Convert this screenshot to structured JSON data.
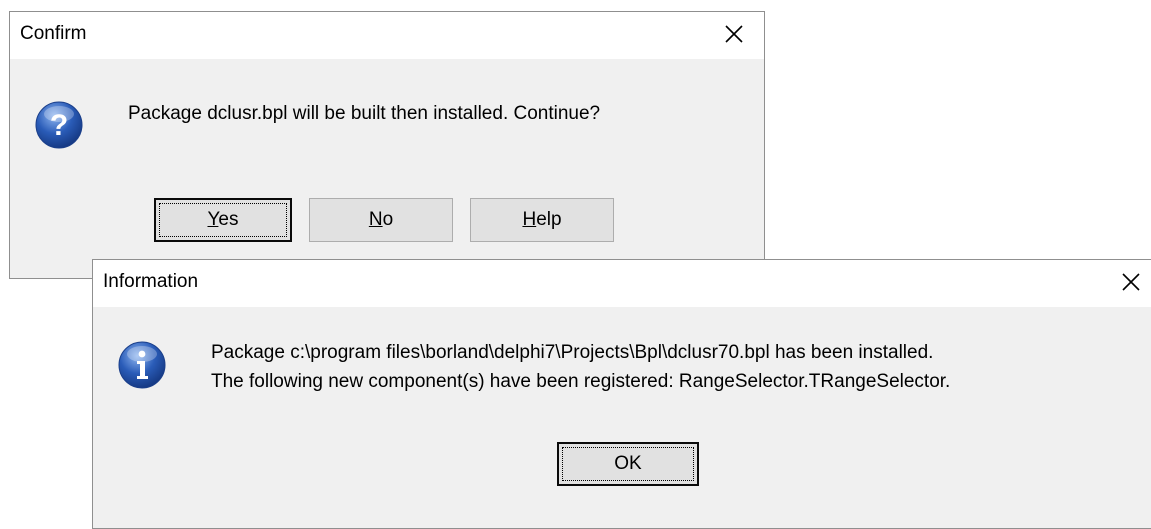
{
  "confirm_dialog": {
    "title": "Confirm",
    "icon": "question-icon",
    "message": "Package dclusr.bpl will be built then installed. Continue?",
    "buttons": [
      {
        "accel": "Y",
        "rest": "es",
        "default": true
      },
      {
        "accel": "N",
        "rest": "o",
        "default": false
      },
      {
        "accel": "H",
        "rest": "elp",
        "default": false
      }
    ]
  },
  "info_dialog": {
    "title": "Information",
    "icon": "information-icon",
    "message_lines": [
      "Package c:\\program files\\borland\\delphi7\\Projects\\Bpl\\dclusr70.bpl has been installed.",
      "The following new component(s) have been registered: RangeSelector.TRangeSelector."
    ],
    "ok_label": "OK"
  },
  "colors": {
    "title_bar": "#ffffff",
    "dialog_body": "#f0f0f0",
    "button_face": "#e1e1e1",
    "icon_blue": "#2a5cb8"
  }
}
